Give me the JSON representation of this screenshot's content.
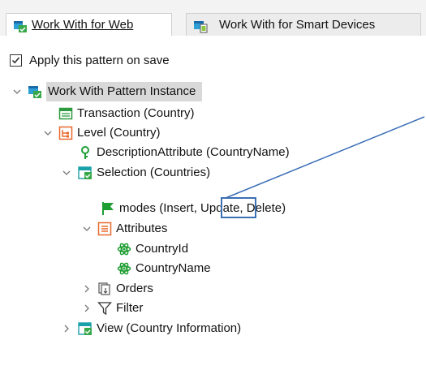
{
  "tabs": [
    {
      "label": "Work With for Web",
      "active": true,
      "icon": "work-with-web-icon"
    },
    {
      "label": "Work With for Smart Devices",
      "active": false,
      "icon": "work-with-smart-devices-icon"
    }
  ],
  "options": {
    "apply_pattern_label": "Apply this pattern on save",
    "apply_pattern_checked": true
  },
  "tree": {
    "root": "Work With Pattern Instance",
    "transaction": "Transaction (Country)",
    "level": "Level (Country)",
    "description_attribute": "DescriptionAttribute (CountryName)",
    "selection": "Selection (Countries)",
    "modes_prefix": "modes ",
    "modes_insert": "(Insert,",
    "modes_rest": " Update, Delete)",
    "attributes": "Attributes",
    "attr_1": "CountryId",
    "attr_2": "CountryName",
    "orders": "Orders",
    "filter": "Filter",
    "view": "View (Country Information)"
  },
  "colors": {
    "accent": "#3b6fb6",
    "selection_bg": "#d9d9d9",
    "level_orange": "#e8692d",
    "green": "#1f9e33",
    "teal": "#1aa0a8"
  }
}
